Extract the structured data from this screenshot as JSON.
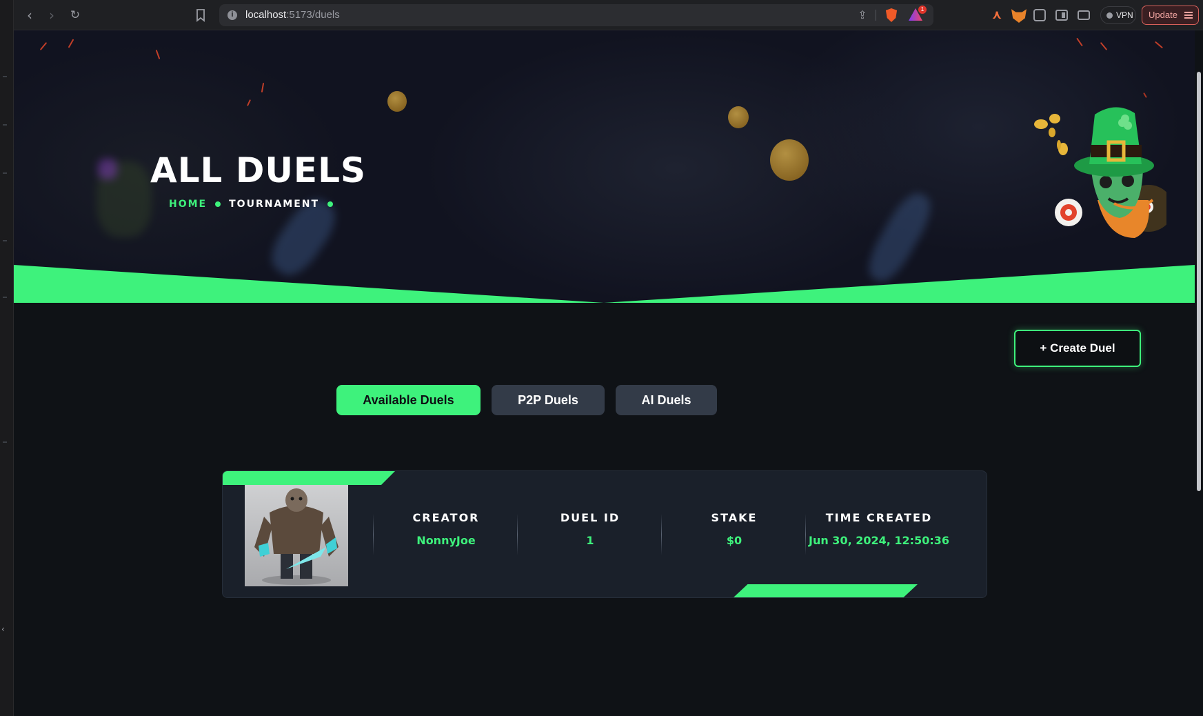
{
  "browser": {
    "url_host": "localhost",
    "url_path": ":5173/duels",
    "rewards_count": "1",
    "vpn_label": "VPN",
    "update_label": "Update"
  },
  "hero": {
    "title": "ALL DUELS",
    "breadcrumb": [
      "HOME",
      "TOURNAMENT"
    ]
  },
  "actions": {
    "create_duel": "+ Create Duel"
  },
  "tabs": [
    {
      "label": "Available Duels",
      "active": true
    },
    {
      "label": "P2P Duels",
      "active": false
    },
    {
      "label": "AI Duels",
      "active": false
    }
  ],
  "duels": [
    {
      "creator_label": "CREATOR",
      "creator": "NonnyJoe",
      "duel_id_label": "DUEL ID",
      "duel_id": "1",
      "stake_label": "STAKE",
      "stake": "$0",
      "time_label": "TIME CREATED",
      "time_created": "Jun 30, 2024, 12:50:36"
    }
  ],
  "colors": {
    "accent": "#3ef27c",
    "card_bg": "#1a202a",
    "tab_inactive": "#333b48"
  }
}
